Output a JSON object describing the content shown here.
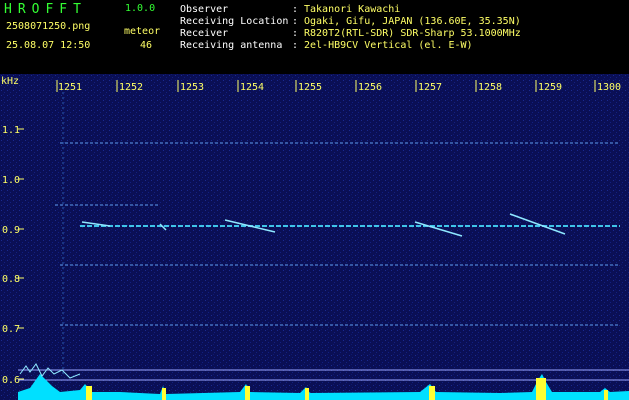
{
  "app": {
    "title": "HROFFT",
    "version": "1.0.0"
  },
  "file": {
    "name": "2508071250.png",
    "datetime": "25.08.07 12:50"
  },
  "meteor": {
    "label": "meteor",
    "count": "46"
  },
  "info": [
    {
      "key": "Observer",
      "value": "Takanori Kawachi"
    },
    {
      "key": "Receiving Location",
      "value": "Ogaki, Gifu, JAPAN (136.60E, 35.35N)"
    },
    {
      "key": "Receiver",
      "value": "R820T2(RTL-SDR) SDR-Sharp 53.1000MHz"
    },
    {
      "key": "Receiving antenna",
      "value": "2el-HB9CV Vertical (el. E-W)"
    }
  ],
  "spectrogram": {
    "yunit": "kHz",
    "time_ticks": [
      "1251",
      "1252",
      "1253",
      "1254",
      "1255",
      "1256",
      "1257",
      "1258",
      "1259",
      "1300"
    ],
    "freq_ticks": [
      "1.1",
      "1.0",
      "0.9",
      "0.8",
      "0.7",
      "0.6"
    ],
    "colors": {
      "background": "#0a0f55",
      "label": "#ffff66",
      "trace": "#00e0ff"
    }
  }
}
